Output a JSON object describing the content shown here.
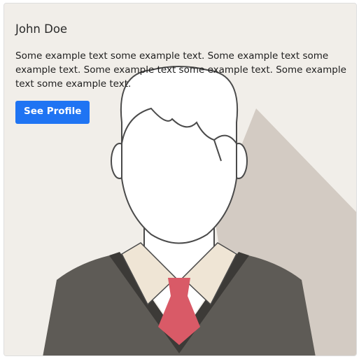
{
  "card": {
    "title": "John Doe",
    "text": "Some example text some example text. Some example text some example text. Some example text some example text. Some example text some example text.",
    "button_label": "See Profile"
  },
  "colors": {
    "button": "#1f74f3",
    "background": "#f1eee9",
    "tie": "#d95a67",
    "sweater": "#5e5b56"
  },
  "image": {
    "icon": "avatar-icon"
  }
}
